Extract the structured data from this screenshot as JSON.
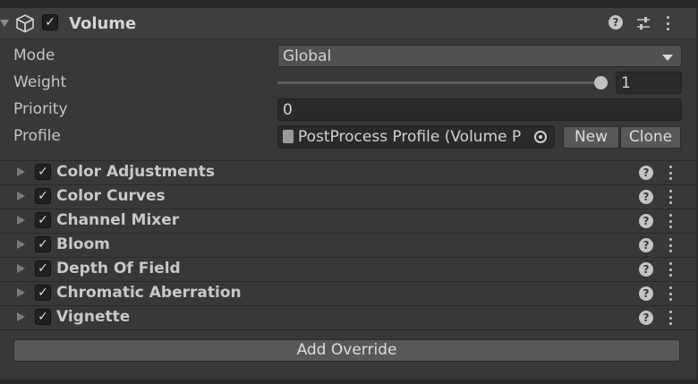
{
  "component": {
    "title": "Volume",
    "enabled": true
  },
  "properties": {
    "mode_label": "Mode",
    "mode_value": "Global",
    "weight_label": "Weight",
    "weight_value": "1",
    "weight_fraction": 1.0,
    "priority_label": "Priority",
    "priority_value": "0",
    "profile_label": "Profile",
    "profile_value": "PostProcess Profile (Volume P",
    "new_label": "New",
    "clone_label": "Clone"
  },
  "overrides": [
    {
      "label": "Color Adjustments",
      "enabled": true
    },
    {
      "label": "Color Curves",
      "enabled": true
    },
    {
      "label": "Channel Mixer",
      "enabled": true
    },
    {
      "label": "Bloom",
      "enabled": true
    },
    {
      "label": "Depth Of Field",
      "enabled": true
    },
    {
      "label": "Chromatic Aberration",
      "enabled": true
    },
    {
      "label": "Vignette",
      "enabled": true
    }
  ],
  "add_override_label": "Add Override",
  "icons": {
    "component": "cube-icon",
    "help": "help-icon",
    "presets": "presets-icon",
    "menu": "kebab-menu-icon",
    "picker": "object-picker-icon"
  }
}
